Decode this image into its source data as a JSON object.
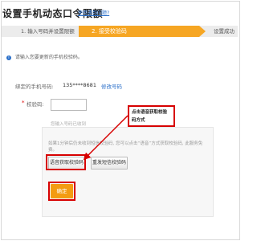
{
  "header": {
    "title": "设置手机动态口令限额",
    "help_link": "使用遇到问题?"
  },
  "steps": {
    "step1": "1. 输入号码并设置限额",
    "step2": "2. 接受校验码",
    "step3": "设置成功"
  },
  "notice": {
    "icon": "info-icon",
    "text": "请输入您要更新的手机校验码。"
  },
  "phone": {
    "label": "绑定的手机号码:",
    "value": "135****8681",
    "modify_link": "修改号码"
  },
  "code": {
    "required_mark": "*",
    "label": "校验码:",
    "value": "",
    "hint": "您输入号码已收到"
  },
  "info_box": {
    "text": "如果1分钟后仍未收到短信校验码, 您可以点击“语音”方式获取校验码, 此服务免费。"
  },
  "buttons": {
    "voice": "语音获取校验码",
    "resend": "重发短信校验码",
    "confirm": "确定"
  },
  "callout": {
    "text": "点击语音获取校验码方式"
  },
  "colors": {
    "active_step": "#f6a623",
    "highlight": "#d70000",
    "link": "#2a6fc9",
    "confirm": "#f39c12"
  }
}
